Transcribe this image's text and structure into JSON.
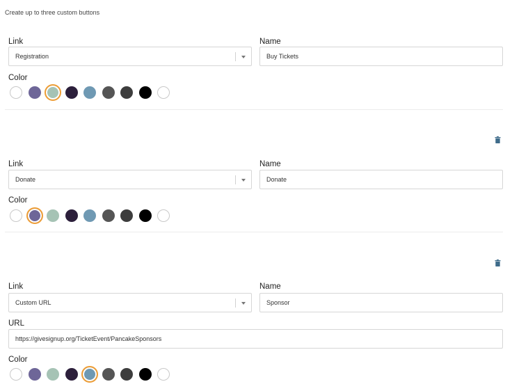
{
  "intro_text": "Create up to three custom buttons",
  "palette": [
    "#ffffff",
    "#6e6698",
    "#a6c3b5",
    "#2c1f3b",
    "#6f99b3",
    "#555555",
    "#3d3d3d",
    "#000000",
    "#ffffff"
  ],
  "accent_color": "#ee9d35",
  "icons": {
    "delete": "trash-icon",
    "dropdown": "chevron-down-icon"
  },
  "buttons": [
    {
      "link_label": "Link",
      "link_value": "Registration",
      "name_label": "Name",
      "name_value": "Buy Tickets",
      "color_label": "Color",
      "selected_color_index": 2
    },
    {
      "link_label": "Link",
      "link_value": "Donate",
      "name_label": "Name",
      "name_value": "Donate",
      "color_label": "Color",
      "selected_color_index": 1
    },
    {
      "link_label": "Link",
      "link_value": "Custom URL",
      "name_label": "Name",
      "name_value": "Sponsor",
      "url_label": "URL",
      "url_value": "https://givesignup.org/TicketEvent/PancakeSponsors",
      "color_label": "Color",
      "selected_color_index": 4
    }
  ]
}
